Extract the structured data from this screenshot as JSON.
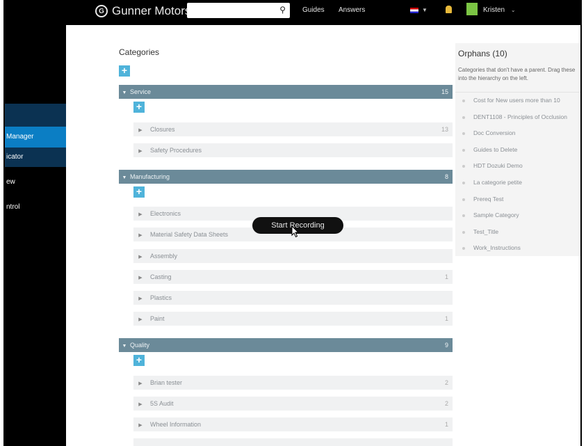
{
  "header": {
    "brand": "Gunner Motors",
    "search_placeholder": "",
    "nav": [
      "Guides",
      "Answers"
    ],
    "user": "Kristen"
  },
  "sidebar": {
    "items": [
      "Manager",
      "icator",
      "ew",
      "ntrol"
    ]
  },
  "main": {
    "title": "Categories",
    "groups": [
      {
        "name": "Service",
        "count": "15",
        "children": [
          {
            "name": "Closures",
            "count": "13"
          },
          {
            "name": "Safety Procedures",
            "count": ""
          }
        ]
      },
      {
        "name": "Manufacturing",
        "count": "8",
        "children": [
          {
            "name": "Electronics",
            "count": ""
          },
          {
            "name": "Material Safety Data Sheets",
            "count": ""
          },
          {
            "name": "Assembly",
            "count": ""
          },
          {
            "name": "Casting",
            "count": "1"
          },
          {
            "name": "Plastics",
            "count": ""
          },
          {
            "name": "Paint",
            "count": "1"
          }
        ]
      },
      {
        "name": "Quality",
        "count": "9",
        "children": [
          {
            "name": "Brian tester",
            "count": "2"
          },
          {
            "name": "5S Audit",
            "count": "2"
          },
          {
            "name": "Wheel Information",
            "count": "1"
          }
        ]
      }
    ]
  },
  "orphans": {
    "title": "Orphans (10)",
    "description": "Categories that don't have a parent. Drag these into the hierarchy on the left.",
    "items": [
      "Cost for New users more than 10",
      "DENT1108 - Principles of Occlusion",
      "Doc Conversion",
      "Guides to Delete",
      "HDT Dozuki Demo",
      "La categorie petite",
      "Prereq Test",
      "Sample Category",
      "Test_Title",
      "Work_Instructions"
    ]
  },
  "overlay": {
    "recording_label": "Start Recording"
  },
  "icons": {
    "add": "plus-icon",
    "expanded": "caret-down-icon",
    "collapsed": "caret-right-icon",
    "search": "search-icon",
    "notifications": "bell-icon"
  },
  "colors": {
    "group_header": "#6b8a99",
    "add_button": "#4fb3da",
    "sidebar_active": "#0b7ec4",
    "child_row": "#f0f1f2"
  }
}
